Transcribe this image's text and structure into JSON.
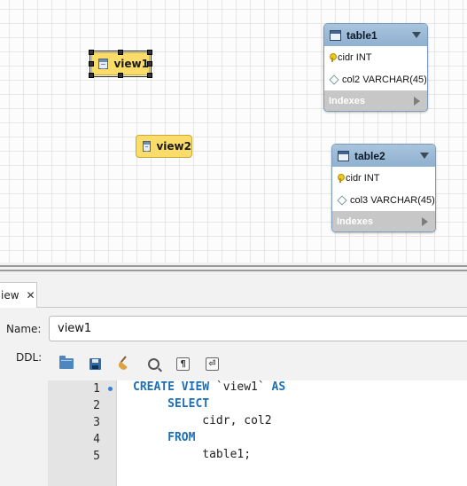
{
  "canvas": {
    "views": [
      {
        "label": "view1",
        "selected": true
      },
      {
        "label": "view2",
        "selected": false
      }
    ],
    "tables": [
      {
        "title": "table1",
        "columns": [
          {
            "text": "cidr INT",
            "icon": "primary-key-icon"
          },
          {
            "text": "col2 VARCHAR(45)",
            "icon": "column-diamond-icon"
          }
        ],
        "indexes_label": "Indexes"
      },
      {
        "title": "table2",
        "columns": [
          {
            "text": "cidr INT",
            "icon": "primary-key-icon"
          },
          {
            "text": "col3 VARCHAR(45)",
            "icon": "column-diamond-icon"
          }
        ],
        "indexes_label": "Indexes"
      }
    ]
  },
  "editor": {
    "tab_label": "iew",
    "close_symbol": "✕",
    "name_label": "Name:",
    "name_value": "view1",
    "ddl_label": "DDL:",
    "toolbar": [
      "open-file-icon",
      "save-icon",
      "beautify-icon",
      "find-icon",
      "invisible-chars-icon",
      "word-wrap-icon"
    ],
    "line_numbers": [
      "1",
      "2",
      "3",
      "4",
      "5"
    ],
    "code": {
      "l1_kw": "CREATE VIEW",
      "l1_name": " `view1` ",
      "l1_as": "AS",
      "l2_kw": "SELECT",
      "l3": "cidr, col2",
      "l4_kw": "FROM",
      "l5": "table1;"
    }
  },
  "colors": {
    "view_fill": "#f9dc69",
    "table_header": "#9fbbd7",
    "indexes_bar": "#c7c7c7",
    "keyword": "#1d6fb5"
  }
}
